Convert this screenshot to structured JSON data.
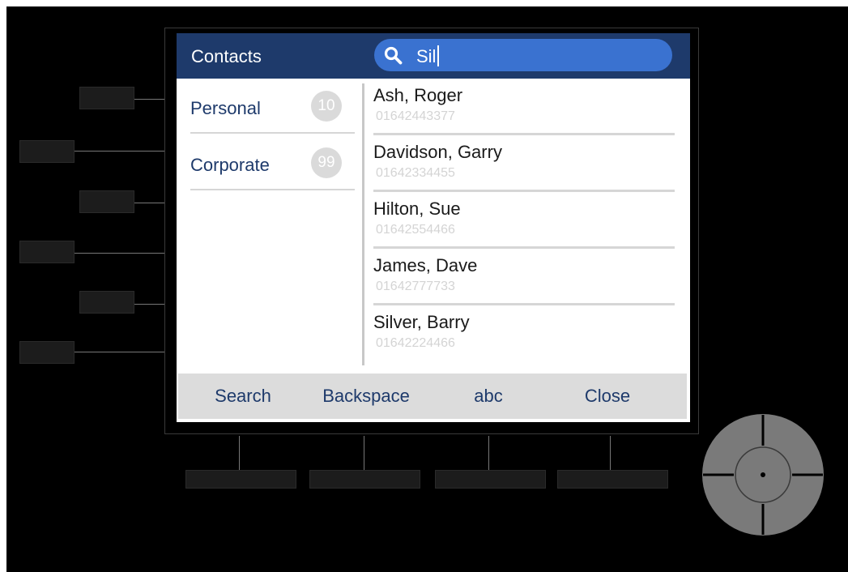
{
  "screen": {
    "title": "Contacts",
    "search": {
      "value": "Sil",
      "icon": "search-icon"
    },
    "categories": [
      {
        "label": "Personal",
        "count": "10"
      },
      {
        "label": "Corporate",
        "count": "99"
      }
    ],
    "contacts": [
      {
        "name": "Ash, Roger",
        "number": "01642443377"
      },
      {
        "name": "Davidson, Garry",
        "number": "01642334455"
      },
      {
        "name": "Hilton, Sue",
        "number": "01642554466"
      },
      {
        "name": "James, Dave",
        "number": "01642777733"
      },
      {
        "name": "Silver, Barry",
        "number": "01642224466"
      }
    ],
    "softkeys": [
      "Search",
      "Backspace",
      "abc",
      "Close"
    ]
  },
  "colors": {
    "header": "#1e3a6b",
    "search_field": "#3a72d0",
    "softkey_bar": "#dcdcdc",
    "device_body": "#000000",
    "nav_pad": "#7a7a7a"
  }
}
